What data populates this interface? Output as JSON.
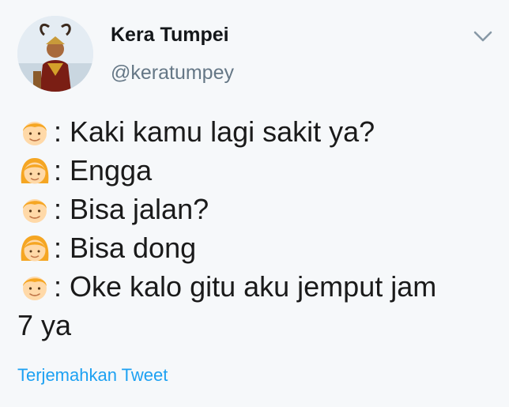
{
  "tweet": {
    "author": {
      "display_name": "Kera Tumpei",
      "handle": "@keratumpey"
    },
    "menu_icon": "chevron-down-icon",
    "lines": [
      {
        "speaker": "boy",
        "icon": "boy-face-emoji",
        "text": ": Kaki kamu lagi sakit ya?"
      },
      {
        "speaker": "girl",
        "icon": "girl-face-emoji",
        "text": ": Engga"
      },
      {
        "speaker": "boy",
        "icon": "boy-face-emoji",
        "text": ": Bisa jalan?"
      },
      {
        "speaker": "girl",
        "icon": "girl-face-emoji",
        "text": ": Bisa dong"
      },
      {
        "speaker": "boy",
        "icon": "boy-face-emoji",
        "text": ": Oke kalo gitu aku jemput jam"
      }
    ],
    "continuation": "7 ya",
    "translate_label": "Terjemahkan Tweet"
  },
  "colors": {
    "accent": "#1da1f2",
    "handle": "#657786",
    "text": "#14171a"
  }
}
